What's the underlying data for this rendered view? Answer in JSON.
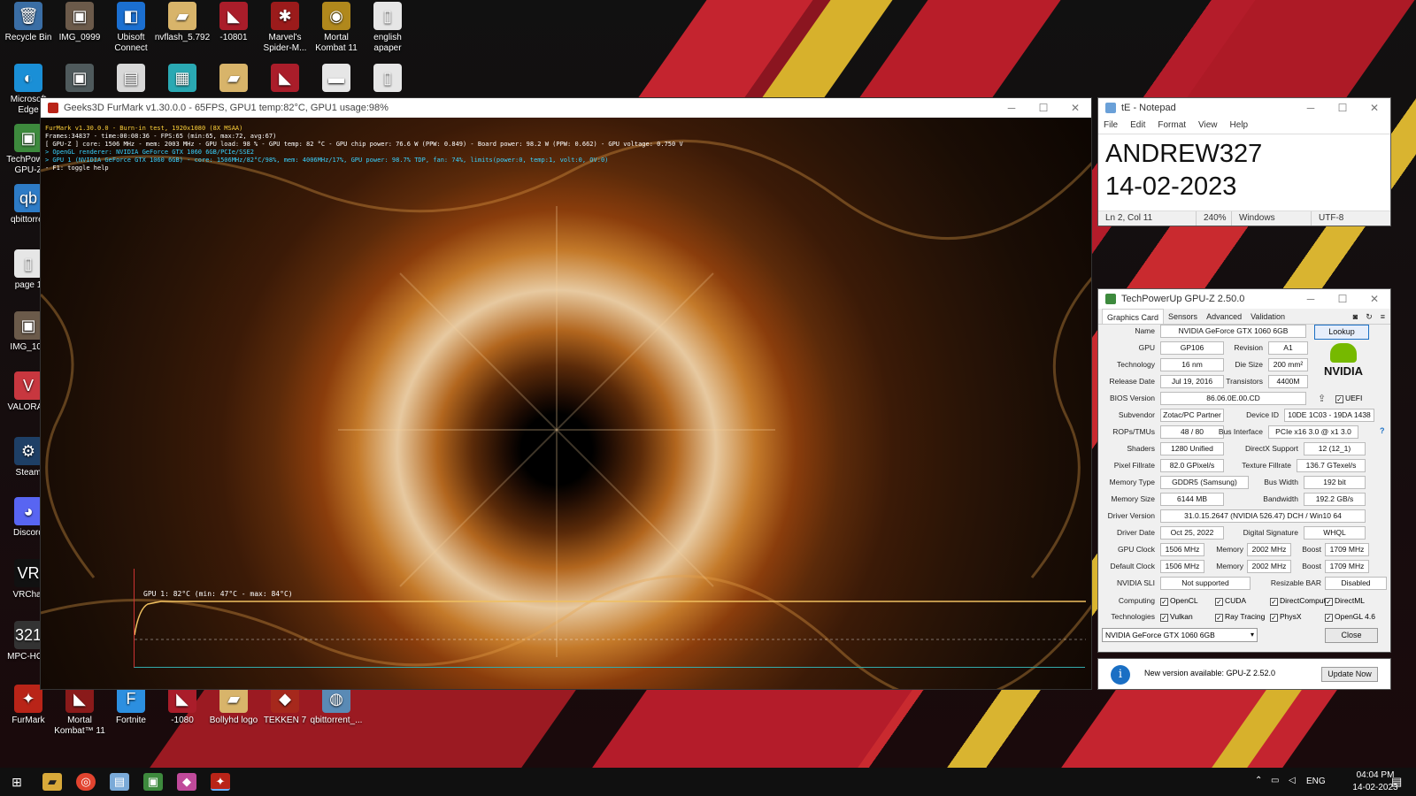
{
  "desktop": {
    "icons": [
      {
        "label": "Recycle Bin",
        "glyph": "🗑",
        "color": "#3a6ea5"
      },
      {
        "label": "IMG_0999",
        "glyph": "▣",
        "color": "#6b5a4a"
      },
      {
        "label": "Ubisoft Connect",
        "glyph": "◧",
        "color": "#1b6fd0"
      },
      {
        "label": "nvflash_5.792",
        "glyph": "▰",
        "color": "#d8b46a"
      },
      {
        "label": "-10801",
        "glyph": "◣",
        "color": "#aa1d2a"
      },
      {
        "label": "Marvel's Spider-M...",
        "glyph": "✱",
        "color": "#9b1b1b"
      },
      {
        "label": "Mortal Kombat 11",
        "glyph": "◉",
        "color": "#b0881c"
      },
      {
        "label": "english apaper",
        "glyph": "▯",
        "color": "#e6e6e6"
      },
      {
        "label": "Microsoft Edge",
        "glyph": "◐",
        "color": "#1a8fd6"
      },
      {
        "label": "",
        "glyph": "▣",
        "color": "#4f5a5c"
      },
      {
        "label": "",
        "glyph": "▤",
        "color": "#d8d8d8"
      },
      {
        "label": "",
        "glyph": "▦",
        "color": "#2aa9b3"
      },
      {
        "label": "",
        "glyph": "▰",
        "color": "#d8b46a"
      },
      {
        "label": "",
        "glyph": "◣",
        "color": "#aa1d2a"
      },
      {
        "label": "",
        "glyph": "▬",
        "color": "#e6e6e6"
      },
      {
        "label": "",
        "glyph": "▯",
        "color": "#e6e6e6"
      },
      {
        "label": "TechPower GPU-Z",
        "glyph": "▣",
        "color": "#3d8a3d"
      },
      {
        "label": "qbittorrer",
        "glyph": "qb",
        "color": "#2d7bc6"
      },
      {
        "label": "page 1",
        "glyph": "▯",
        "color": "#e6e6e6"
      },
      {
        "label": "IMG_109",
        "glyph": "▣",
        "color": "#6b5a4a"
      },
      {
        "label": "VALORAN",
        "glyph": "V",
        "color": "#c8373f"
      },
      {
        "label": "Steam",
        "glyph": "⚙",
        "color": "#1e3f66"
      },
      {
        "label": "Discord",
        "glyph": "◕",
        "color": "#5865f2"
      },
      {
        "label": "VRChat",
        "glyph": "VR",
        "color": "#111111"
      },
      {
        "label": "MPC-HC x",
        "glyph": "321",
        "color": "#333333"
      },
      {
        "label": "FurMark",
        "glyph": "✦",
        "color": "#b92418"
      },
      {
        "label": "Mortal Kombat™ 11",
        "glyph": "◣",
        "color": "#8a1a1a"
      },
      {
        "label": "Fortnite",
        "glyph": "F",
        "color": "#2c8fe0"
      },
      {
        "label": "-1080",
        "glyph": "◣",
        "color": "#aa1d2a"
      },
      {
        "label": "Bollyhd logo",
        "glyph": "▰",
        "color": "#d8b46a"
      },
      {
        "label": "TEKKEN 7",
        "glyph": "◆",
        "color": "#a6281c"
      },
      {
        "label": "qbittorrent_...",
        "glyph": "◍",
        "color": "#5a8ab5"
      }
    ]
  },
  "furmark": {
    "title": "Geeks3D FurMark v1.30.0.0 - 65FPS, GPU1 temp:82°C, GPU1 usage:98%",
    "info_lines": [
      {
        "text": "FurMark v1.30.0.0 - Burn-in test, 1920x1080 (8X MSAA)",
        "color": "#ffd23a"
      },
      {
        "text": "Frames:34837 - time:00:08:36 - FPS:65 (min:65, max:72, avg:67)",
        "color": "#ffffff"
      },
      {
        "text": "[ GPU-Z ] core: 1506 MHz - mem: 2003 MHz - GPU load: 98 % - GPU temp: 82 °C - GPU chip power: 76.6 W (PPW: 0.849) - Board power: 98.2 W (PPW: 0.662) - GPU voltage: 0.750 V",
        "color": "#ffffff"
      },
      {
        "text": "> OpenGL renderer: NVIDIA GeForce GTX 1060 6GB/PCIe/SSE2",
        "color": "#39d2ff"
      },
      {
        "text": "> GPU 1 (NVIDIA GeForce GTX 1060 6GB) - core: 1506MHz/82°C/98%, mem: 4006MHz/17%, GPU power: 98.7% TDP, fan: 74%, limits(power:0, temp:1, volt:0, OV:0)",
        "color": "#39d2ff"
      },
      {
        "text": "- F1: toggle help",
        "color": "#ffffff"
      }
    ],
    "graph_label": "GPU 1: 82°C (min: 47°C - max: 84°C)"
  },
  "notepad": {
    "title": "tE - Notepad",
    "menu": [
      "File",
      "Edit",
      "Format",
      "View",
      "Help"
    ],
    "lines": [
      "ANDREW327",
      "14-02-2023"
    ],
    "status": {
      "position": "Ln 2, Col 11",
      "zoom": "240%",
      "eol": "Windows (CRLF)",
      "encoding": "UTF-8"
    }
  },
  "gpuz": {
    "title": "TechPowerUp GPU-Z 2.50.0",
    "tabs": [
      "Graphics Card",
      "Sensors",
      "Advanced",
      "Validation"
    ],
    "name": "NVIDIA GeForce GTX 1060 6GB",
    "lookup": "Lookup",
    "gpu": "GP106",
    "revision": "A1",
    "technology": "16 nm",
    "die_size": "200 mm²",
    "release_date": "Jul 19, 2016",
    "transistors": "4400M",
    "bios_version": "86.06.0E.00.CD",
    "uefi": "UEFI",
    "subvendor": "Zotac/PC Partner",
    "device_id": "10DE 1C03 - 19DA 1438",
    "rops_tmus": "48 / 80",
    "bus_interface": "PCIe x16 3.0 @ x1 3.0",
    "shaders": "1280 Unified",
    "directx_support": "12 (12_1)",
    "pixel_fillrate": "82.0 GPixel/s",
    "texture_fillrate": "136.7 GTexel/s",
    "memory_type": "GDDR5 (Samsung)",
    "bus_width": "192 bit",
    "memory_size": "6144 MB",
    "bandwidth": "192.2 GB/s",
    "driver_version": "31.0.15.2647 (NVIDIA 526.47) DCH / Win10 64",
    "driver_date": "Oct 25, 2022",
    "digital_signature": "WHQL",
    "gpu_clock": "1506 MHz",
    "memory_clock": "2002 MHz",
    "boost": "1709 MHz",
    "default_clock": "1506 MHz",
    "default_memory": "2002 MHz",
    "default_boost": "1709 MHz",
    "nvidia_sli": "Not supported",
    "resizable_bar": "Disabled",
    "computing": [
      "OpenCL",
      "CUDA",
      "DirectCompute",
      "DirectML"
    ],
    "technologies": [
      "Vulkan",
      "Ray Tracing",
      "PhysX",
      "OpenGL 4.6"
    ],
    "labels": {
      "name": "Name",
      "gpu": "GPU",
      "revision": "Revision",
      "technology": "Technology",
      "die_size": "Die Size",
      "release_date": "Release Date",
      "transistors": "Transistors",
      "bios_version": "BIOS Version",
      "subvendor": "Subvendor",
      "device_id": "Device ID",
      "rops_tmus": "ROPs/TMUs",
      "bus_interface": "Bus Interface",
      "shaders": "Shaders",
      "directx_support": "DirectX Support",
      "pixel_fillrate": "Pixel Fillrate",
      "texture_fillrate": "Texture Fillrate",
      "memory_type": "Memory Type",
      "bus_width": "Bus Width",
      "memory_size": "Memory Size",
      "bandwidth": "Bandwidth",
      "driver_version": "Driver Version",
      "driver_date": "Driver Date",
      "digital_signature": "Digital Signature",
      "gpu_clock": "GPU Clock",
      "memory": "Memory",
      "boost": "Boost",
      "default_clock": "Default Clock",
      "nvidia_sli": "NVIDIA SLI",
      "resizable_bar": "Resizable BAR",
      "computing": "Computing",
      "technologies": "Technologies"
    },
    "selected_gpu": "NVIDIA GeForce GTX 1060 6GB",
    "close": "Close",
    "update_text": "New version available: GPU-Z 2.52.0",
    "update_button": "Update Now",
    "brand": "NVIDIA"
  },
  "taskbar": {
    "language": "ENG",
    "time": "04:04 PM",
    "date": "14-02-2023"
  },
  "colors": {
    "accent": "#c92a2f",
    "gpuz_blue": "#1a6fc4",
    "nvidia_green": "#76b900"
  }
}
